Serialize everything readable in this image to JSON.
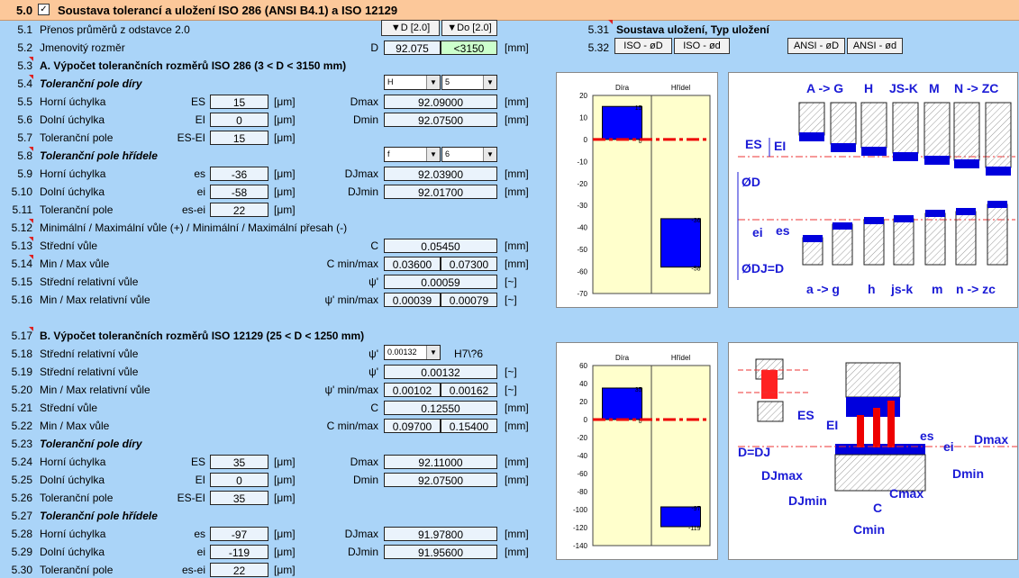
{
  "header": {
    "num": "5.0",
    "checkbox": "✓",
    "title": "Soustava tolerancí a uložení ISO 286 (ANSI B4.1) a ISO 12129"
  },
  "row51": {
    "num": "5.1",
    "label": "Přenos průměrů z odstavce 2.0",
    "btn1": "▼D [2.0]",
    "btn2": "▼Do [2.0]"
  },
  "row52": {
    "num": "5.2",
    "label": "Jmenovitý rozměr",
    "sym": "D",
    "val": "92.075",
    "range": "<3150",
    "unit": "[mm]"
  },
  "row531": {
    "num": "5.31",
    "label": "Soustava uložení, Typ uložení"
  },
  "row532": {
    "num": "5.32",
    "b1": "ISO - øD",
    "b2": "ISO - ød",
    "b3": "ANSI - øD",
    "b4": "ANSI - ød"
  },
  "row53": {
    "num": "5.3",
    "label": "A. Výpočet tolerančních rozměrů ISO 286 (3 < D < 3150 mm)"
  },
  "row54": {
    "num": "5.4",
    "label": "Toleranční pole díry",
    "dd1": "H",
    "dd2": "5"
  },
  "row55": {
    "num": "5.5",
    "label": "Horní úchylka",
    "sym": "ES",
    "val": "15",
    "unit": "[μm]",
    "sym2": "Dmax",
    "val2": "92.09000",
    "unit2": "[mm]"
  },
  "row56": {
    "num": "5.6",
    "label": "Dolní úchylka",
    "sym": "EI",
    "val": "0",
    "unit": "[μm]",
    "sym2": "Dmin",
    "val2": "92.07500",
    "unit2": "[mm]"
  },
  "row57": {
    "num": "5.7",
    "label": "Toleranční pole",
    "sym": "ES-EI",
    "val": "15",
    "unit": "[μm]"
  },
  "row58": {
    "num": "5.8",
    "label": "Toleranční pole hřídele",
    "dd1": "f",
    "dd2": "6"
  },
  "row59": {
    "num": "5.9",
    "label": "Horní úchylka",
    "sym": "es",
    "val": "-36",
    "unit": "[μm]",
    "sym2": "DJmax",
    "val2": "92.03900",
    "unit2": "[mm]"
  },
  "row510": {
    "num": "5.10",
    "label": "Dolní úchylka",
    "sym": "ei",
    "val": "-58",
    "unit": "[μm]",
    "sym2": "DJmin",
    "val2": "92.01700",
    "unit2": "[mm]"
  },
  "row511": {
    "num": "5.11",
    "label": "Toleranční pole",
    "sym": "es-ei",
    "val": "22",
    "unit": "[μm]"
  },
  "row512": {
    "num": "5.12",
    "label": "Minimální / Maximální vůle (+) / Minimální / Maximální přesah (-)"
  },
  "row513": {
    "num": "5.13",
    "label": "Střední vůle",
    "sym": "C",
    "val": "0.05450",
    "unit": "[mm]"
  },
  "row514": {
    "num": "5.14",
    "label": "Min / Max vůle",
    "sym": "C min/max",
    "v1": "0.03600",
    "v2": "0.07300",
    "unit": "[mm]"
  },
  "row515": {
    "num": "5.15",
    "label": "Střední relativní vůle",
    "sym": "ψ'",
    "val": "0.00059",
    "unit": "[~]"
  },
  "row516": {
    "num": "5.16",
    "label": "Min / Max relativní vůle",
    "sym": "ψ' min/max",
    "v1": "0.00039",
    "v2": "0.00079",
    "unit": "[~]"
  },
  "row517": {
    "num": "5.17",
    "label": "B. Výpočet tolerančních rozměrů ISO 12129 (25 < D < 1250 mm)"
  },
  "row518": {
    "num": "5.18",
    "label": "Střední relativní vůle",
    "sym": "ψ'",
    "dd": "0.00132",
    "fit": "H7\\?6"
  },
  "row519": {
    "num": "5.19",
    "label": "Střední relativní vůle",
    "sym": "ψ'",
    "val": "0.00132",
    "unit": "[~]"
  },
  "row520": {
    "num": "5.20",
    "label": "Min / Max relativní vůle",
    "sym": "ψ' min/max",
    "v1": "0.00102",
    "v2": "0.00162",
    "unit": "[~]"
  },
  "row521": {
    "num": "5.21",
    "label": "Střední vůle",
    "sym": "C",
    "val": "0.12550",
    "unit": "[mm]"
  },
  "row522": {
    "num": "5.22",
    "label": "Min / Max vůle",
    "sym": "C min/max",
    "v1": "0.09700",
    "v2": "0.15400",
    "unit": "[mm]"
  },
  "row523": {
    "num": "5.23",
    "label": "Toleranční pole díry"
  },
  "row524": {
    "num": "5.24",
    "label": "Horní úchylka",
    "sym": "ES",
    "val": "35",
    "unit": "[μm]",
    "sym2": "Dmax",
    "val2": "92.11000",
    "unit2": "[mm]"
  },
  "row525": {
    "num": "5.25",
    "label": "Dolní úchylka",
    "sym": "EI",
    "val": "0",
    "unit": "[μm]",
    "sym2": "Dmin",
    "val2": "92.07500",
    "unit2": "[mm]"
  },
  "row526": {
    "num": "5.26",
    "label": "Toleranční pole",
    "sym": "ES-EI",
    "val": "35",
    "unit": "[μm]"
  },
  "row527": {
    "num": "5.27",
    "label": "Toleranční pole hřídele"
  },
  "row528": {
    "num": "5.28",
    "label": "Horní úchylka",
    "sym": "es",
    "val": "-97",
    "unit": "[μm]",
    "sym2": "DJmax",
    "val2": "91.97800",
    "unit2": "[mm]"
  },
  "row529": {
    "num": "5.29",
    "label": "Dolní úchylka",
    "sym": "ei",
    "val": "-119",
    "unit": "[μm]",
    "sym2": "DJmin",
    "val2": "91.95600",
    "unit2": "[mm]"
  },
  "row530": {
    "num": "5.30",
    "label": "Toleranční pole",
    "sym": "es-ei",
    "val": "22",
    "unit": "[μm]"
  },
  "chart_data": [
    {
      "type": "bar",
      "categories": [
        "Díra",
        "Hřídel"
      ],
      "ylim": [
        -70,
        20
      ],
      "yticks": [
        20,
        10,
        0,
        -10,
        -20,
        -30,
        -40,
        -50,
        -60,
        -70
      ],
      "series": [
        {
          "values": [
            [
              0,
              15
            ],
            [
              -58,
              -36
            ]
          ]
        }
      ],
      "labels": [
        [
          "15",
          "0"
        ],
        [
          "-36",
          "-58"
        ]
      ]
    },
    {
      "type": "bar",
      "categories": [
        "Díra",
        "Hřídel"
      ],
      "ylim": [
        -140,
        60
      ],
      "yticks": [
        60,
        40,
        20,
        0,
        -20,
        -40,
        -60,
        -80,
        -100,
        -120,
        -140
      ],
      "series": [
        {
          "values": [
            [
              0,
              35
            ],
            [
              -119,
              -97
            ]
          ]
        }
      ],
      "labels": [
        [
          "35",
          "0"
        ],
        [
          "-97",
          "-119"
        ]
      ]
    }
  ],
  "diagram1": {
    "top": [
      "A -> G",
      "H",
      "JS-K",
      "M",
      "N -> ZC"
    ],
    "bottom": [
      "a -> g",
      "h",
      "js-k",
      "m",
      "n -> zc"
    ],
    "es": "ES",
    "ei_up": "EI",
    "od": "ØD",
    "ei": "ei",
    "es_low": "es",
    "odj": "ØDJ=D"
  },
  "diagram2": {
    "es": "ES",
    "ei": "EI",
    "es2": "es",
    "ei2": "ei",
    "dmax": "Dmax",
    "dmin": "Dmin",
    "ddj": "D=DJ",
    "djmax": "DJmax",
    "djmin": "DJmin",
    "c": "C",
    "cmax": "Cmax",
    "cmin": "Cmin"
  },
  "colors": {
    "bg": "#aad4f8",
    "header": "#fcc89a",
    "bar": "#0000ff",
    "zero": "#ee0000",
    "plotbg": "#ffffcc",
    "green": "#ccffcc"
  }
}
